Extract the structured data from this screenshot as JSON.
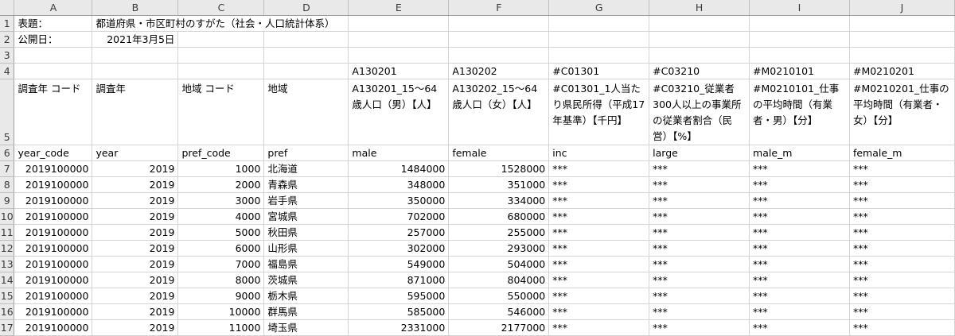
{
  "columns": [
    "A",
    "B",
    "C",
    "D",
    "E",
    "F",
    "G",
    "H",
    "I",
    "J"
  ],
  "row_numbers": [
    "1",
    "2",
    "3",
    "4",
    "5",
    "6",
    "7",
    "8",
    "9",
    "10",
    "11",
    "12",
    "13",
    "14",
    "15",
    "16",
    "17"
  ],
  "rows": [
    [
      "表題：",
      "都道府県・市区町村のすがた（社会・人口統計体系）",
      "",
      "",
      "",
      "",
      "",
      "",
      "",
      ""
    ],
    [
      "公開日：",
      "2021年3月5日",
      "",
      "",
      "",
      "",
      "",
      "",
      "",
      ""
    ],
    [
      "",
      "",
      "",
      "",
      "",
      "",
      "",
      "",
      "",
      ""
    ],
    [
      "",
      "",
      "",
      "",
      "A130201",
      "A130202",
      "#C01301",
      "#C03210",
      "#M0210101",
      "#M0210201"
    ],
    [
      "調査年 コード",
      "調査年",
      "地域 コード",
      "地域",
      "A130201_15～64歳人口（男）【人】",
      "A130202_15～64歳人口（女）【人】",
      "#C01301_1人当たり県民所得（平成17年基準）【千円】",
      "#C03210_従業者300人以上の事業所の従業者割合（民営）【%】",
      "#M0210101_仕事の平均時間（有業者・男）【分】",
      "#M0210201_仕事の平均時間（有業者・女）【分】"
    ],
    [
      "year_code",
      "year",
      "pref_code",
      "pref",
      "male",
      "female",
      "inc",
      "large",
      "male_m",
      "female_m"
    ],
    [
      "2019100000",
      "2019",
      "1000",
      "北海道",
      "1484000",
      "1528000",
      "***",
      "***",
      "***",
      "***"
    ],
    [
      "2019100000",
      "2019",
      "2000",
      "青森県",
      "348000",
      "351000",
      "***",
      "***",
      "***",
      "***"
    ],
    [
      "2019100000",
      "2019",
      "3000",
      "岩手県",
      "350000",
      "334000",
      "***",
      "***",
      "***",
      "***"
    ],
    [
      "2019100000",
      "2019",
      "4000",
      "宮城県",
      "702000",
      "680000",
      "***",
      "***",
      "***",
      "***"
    ],
    [
      "2019100000",
      "2019",
      "5000",
      "秋田県",
      "257000",
      "255000",
      "***",
      "***",
      "***",
      "***"
    ],
    [
      "2019100000",
      "2019",
      "6000",
      "山形県",
      "302000",
      "293000",
      "***",
      "***",
      "***",
      "***"
    ],
    [
      "2019100000",
      "2019",
      "7000",
      "福島県",
      "549000",
      "504000",
      "***",
      "***",
      "***",
      "***"
    ],
    [
      "2019100000",
      "2019",
      "8000",
      "茨城県",
      "871000",
      "804000",
      "***",
      "***",
      "***",
      "***"
    ],
    [
      "2019100000",
      "2019",
      "9000",
      "栃木県",
      "595000",
      "550000",
      "***",
      "***",
      "***",
      "***"
    ],
    [
      "2019100000",
      "2019",
      "10000",
      "群馬県",
      "585000",
      "546000",
      "***",
      "***",
      "***",
      "***"
    ],
    [
      "2019100000",
      "2019",
      "11000",
      "埼玉県",
      "2331000",
      "2177000",
      "***",
      "***",
      "***",
      "***"
    ]
  ]
}
